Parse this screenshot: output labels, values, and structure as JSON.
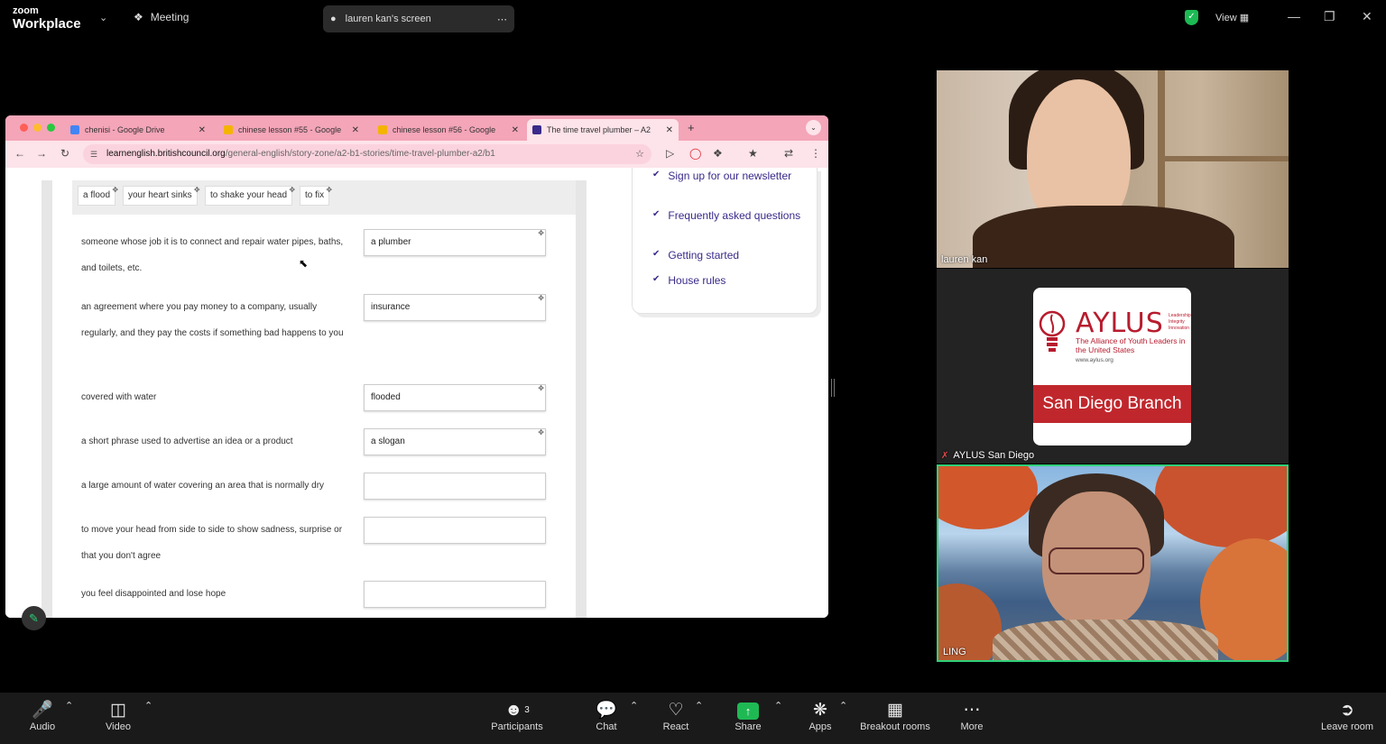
{
  "topbar": {
    "logo_line1": "zoom",
    "logo_line2": "Workplace",
    "meeting_label": "Meeting",
    "screen_label": "lauren kan's screen",
    "view_label": "View"
  },
  "browser": {
    "tabs": [
      {
        "label": "chenisi - Google Drive",
        "color": "#4285f4"
      },
      {
        "label": "chinese lesson #55 - Google",
        "color": "#f4b400"
      },
      {
        "label": "chinese lesson #56 - Google",
        "color": "#f4b400"
      },
      {
        "label": "The time travel plumber – A2",
        "color": "#3a2a8a"
      }
    ],
    "url_site": "learnenglish.britishcouncil.org",
    "url_path": "/general-english/story-zone/a2-b1-stories/time-travel-plumber-a2/b1"
  },
  "exercise": {
    "chips": [
      "a flood",
      "your heart sinks",
      "to shake your head",
      "to fix"
    ],
    "questions": [
      {
        "text": "someone whose job it is to connect and repair water pipes, baths, and toilets, etc.",
        "answer": "a plumber"
      },
      {
        "text": "an agreement where you pay money to a company, usually regularly, and they pay the costs if something bad happens to you",
        "answer": "insurance"
      },
      {
        "text": "covered with water",
        "answer": "flooded"
      },
      {
        "text": "a short phrase used to advertise an idea or a product",
        "answer": "a slogan"
      },
      {
        "text": "a large amount of water covering an area that is normally dry",
        "answer": ""
      },
      {
        "text": "to move your head from side to side to show sadness, surprise or that you don't agree",
        "answer": ""
      },
      {
        "text": "you feel disappointed and lose hope",
        "answer": ""
      }
    ]
  },
  "sidebar": {
    "items": [
      "Sign up for our newsletter",
      "Frequently asked questions",
      "Getting started",
      "House rules"
    ]
  },
  "participants_panel": {
    "tile1_name": "lauren kan",
    "tile2_name": "AYLUS San Diego",
    "tile3_name": "LING",
    "aylus_title": "AYLUS",
    "aylus_tagline": [
      "Leadership",
      "Integrity",
      "Innovation"
    ],
    "aylus_subtitle": "The Alliance of Youth Leaders in the United States",
    "aylus_url": "www.aylus.org",
    "aylus_branch": "San Diego Branch",
    "colors": {
      "aylus_red": "#c0272d",
      "active_speaker": "#2fd07a"
    }
  },
  "toolbar": {
    "audio": "Audio",
    "video": "Video",
    "participants": "Participants",
    "participants_count": "3",
    "chat": "Chat",
    "react": "React",
    "share": "Share",
    "apps": "Apps",
    "breakout": "Breakout rooms",
    "more": "More",
    "leave": "Leave room"
  }
}
